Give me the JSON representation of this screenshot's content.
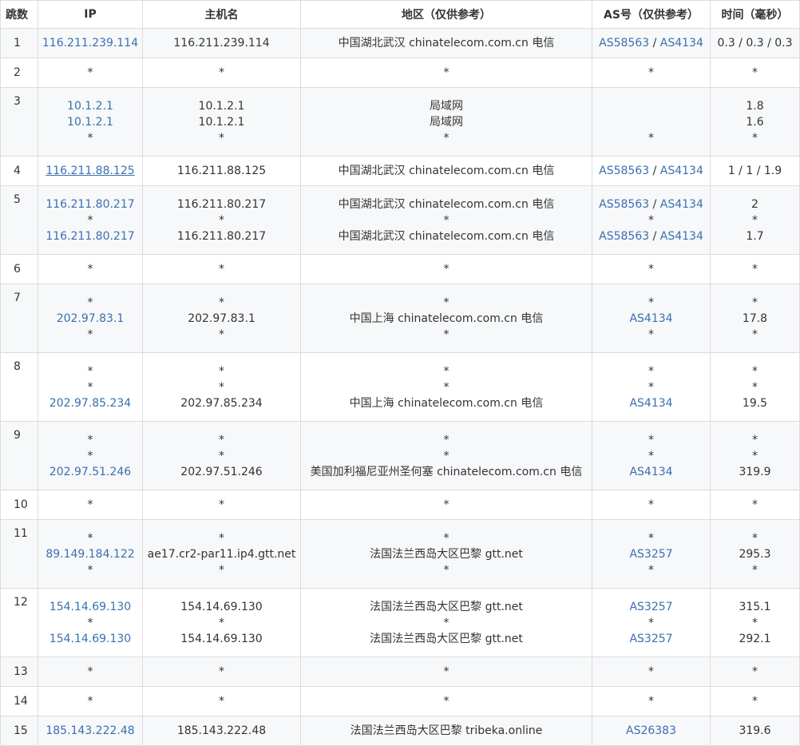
{
  "headers": {
    "hop": "跳数",
    "ip": "IP",
    "host": "主机名",
    "region": "地区（仅供参考）",
    "as": "AS号（仅供参考）",
    "time": "时间（毫秒）"
  },
  "as_separator": " / ",
  "rows": [
    {
      "hop": "1",
      "ip": [
        "116.211.239.114"
      ],
      "host": [
        "116.211.239.114"
      ],
      "region": [
        "中国湖北武汉 chinatelecom.com.cn 电信"
      ],
      "as": [
        [
          "AS58563",
          "AS4134"
        ]
      ],
      "time": [
        "0.3 / 0.3 / 0.3"
      ]
    },
    {
      "hop": "2",
      "ip": [
        "*"
      ],
      "host": [
        "*"
      ],
      "region": [
        "*"
      ],
      "as": [
        "*"
      ],
      "time": [
        "*"
      ]
    },
    {
      "hop": "3",
      "ip": [
        "10.1.2.1",
        "10.1.2.1",
        "*"
      ],
      "host": [
        "10.1.2.1",
        "10.1.2.1",
        "*"
      ],
      "region": [
        "局域网",
        "局域网",
        "*"
      ],
      "as": [
        "",
        "",
        "*"
      ],
      "time": [
        "1.8",
        "1.6",
        "*"
      ]
    },
    {
      "hop": "4",
      "ip": [
        "116.211.88.125"
      ],
      "host": [
        "116.211.88.125"
      ],
      "region": [
        "中国湖北武汉 chinatelecom.com.cn 电信"
      ],
      "as": [
        [
          "AS58563",
          "AS4134"
        ]
      ],
      "time": [
        "1 / 1 / 1.9"
      ]
    },
    {
      "hop": "5",
      "ip": [
        "116.211.80.217",
        "*",
        "116.211.80.217"
      ],
      "host": [
        "116.211.80.217",
        "*",
        "116.211.80.217"
      ],
      "region": [
        "中国湖北武汉 chinatelecom.com.cn 电信",
        "*",
        "中国湖北武汉 chinatelecom.com.cn 电信"
      ],
      "as": [
        [
          "AS58563",
          "AS4134"
        ],
        "*",
        [
          "AS58563",
          "AS4134"
        ]
      ],
      "time": [
        "2",
        "*",
        "1.7"
      ]
    },
    {
      "hop": "6",
      "ip": [
        "*"
      ],
      "host": [
        "*"
      ],
      "region": [
        "*"
      ],
      "as": [
        "*"
      ],
      "time": [
        "*"
      ]
    },
    {
      "hop": "7",
      "ip": [
        "*",
        "202.97.83.1",
        "*"
      ],
      "host": [
        "*",
        "202.97.83.1",
        "*"
      ],
      "region": [
        "*",
        "中国上海 chinatelecom.com.cn 电信",
        "*"
      ],
      "as": [
        "*",
        [
          "AS4134"
        ],
        "*"
      ],
      "time": [
        "*",
        "17.8",
        "*"
      ]
    },
    {
      "hop": "8",
      "ip": [
        "*",
        "*",
        "202.97.85.234"
      ],
      "host": [
        "*",
        "*",
        "202.97.85.234"
      ],
      "region": [
        "*",
        "*",
        "中国上海 chinatelecom.com.cn 电信"
      ],
      "as": [
        "*",
        "*",
        [
          "AS4134"
        ]
      ],
      "time": [
        "*",
        "*",
        "19.5"
      ]
    },
    {
      "hop": "9",
      "ip": [
        "*",
        "*",
        "202.97.51.246"
      ],
      "host": [
        "*",
        "*",
        "202.97.51.246"
      ],
      "region": [
        "*",
        "*",
        "美国加利福尼亚州圣何塞 chinatelecom.com.cn 电信"
      ],
      "as": [
        "*",
        "*",
        [
          "AS4134"
        ]
      ],
      "time": [
        "*",
        "*",
        "319.9"
      ]
    },
    {
      "hop": "10",
      "ip": [
        "*"
      ],
      "host": [
        "*"
      ],
      "region": [
        "*"
      ],
      "as": [
        "*"
      ],
      "time": [
        "*"
      ]
    },
    {
      "hop": "11",
      "ip": [
        "*",
        "89.149.184.122",
        "*"
      ],
      "host": [
        "*",
        "ae17.cr2-par11.ip4.gtt.net",
        "*"
      ],
      "region": [
        "*",
        "法国法兰西岛大区巴黎 gtt.net",
        "*"
      ],
      "as": [
        "*",
        [
          "AS3257"
        ],
        "*"
      ],
      "time": [
        "*",
        "295.3",
        "*"
      ]
    },
    {
      "hop": "12",
      "ip": [
        "154.14.69.130",
        "*",
        "154.14.69.130"
      ],
      "host": [
        "154.14.69.130",
        "*",
        "154.14.69.130"
      ],
      "region": [
        "法国法兰西岛大区巴黎 gtt.net",
        "*",
        "法国法兰西岛大区巴黎 gtt.net"
      ],
      "as": [
        [
          "AS3257"
        ],
        "*",
        [
          "AS3257"
        ]
      ],
      "time": [
        "315.1",
        "*",
        "292.1"
      ]
    },
    {
      "hop": "13",
      "ip": [
        "*"
      ],
      "host": [
        "*"
      ],
      "region": [
        "*"
      ],
      "as": [
        "*"
      ],
      "time": [
        "*"
      ]
    },
    {
      "hop": "14",
      "ip": [
        "*"
      ],
      "host": [
        "*"
      ],
      "region": [
        "*"
      ],
      "as": [
        "*"
      ],
      "time": [
        "*"
      ]
    },
    {
      "hop": "15",
      "ip": [
        "185.143.222.48"
      ],
      "host": [
        "185.143.222.48"
      ],
      "region": [
        "法国法兰西岛大区巴黎 tribeka.online"
      ],
      "as": [
        [
          "AS26383"
        ]
      ],
      "time": [
        "319.6"
      ]
    }
  ],
  "underlined_ip": "116.211.88.125",
  "colors": {
    "link": "#3a6fb0",
    "text": "#333333",
    "border": "#dcdcdc",
    "row_alt": "#f7f8fa"
  }
}
